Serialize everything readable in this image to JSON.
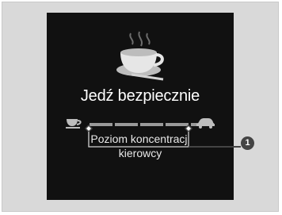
{
  "screen": {
    "message": "Jedź bezpiecznie",
    "meter_label_line1": "Poziom koncentracji",
    "meter_label_line2": "kierowcy",
    "meter_segments": 5,
    "meter_level_segments_filled": 5
  },
  "callout": {
    "number": "1"
  },
  "icons": {
    "top": "coffee-cup-icon",
    "meter_left": "coffee-cup-icon",
    "meter_right": "car-icon"
  },
  "colors": {
    "background": "#d9d9d9",
    "screen": "#111111",
    "text": "#ffffff",
    "meter": "#9a9a9a",
    "callout": "#444444"
  }
}
